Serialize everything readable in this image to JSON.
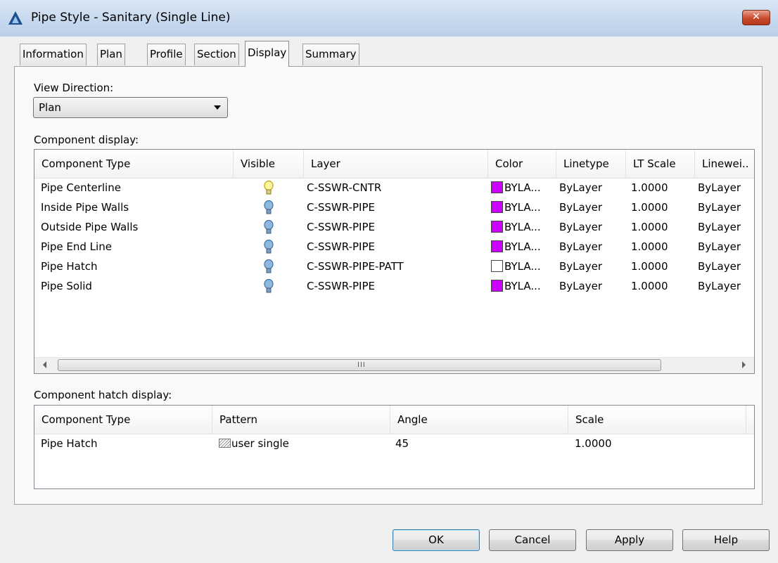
{
  "window": {
    "title": "Pipe Style - Sanitary (Single Line)",
    "close_glyph": "✕"
  },
  "tabs": [
    {
      "label": "Information"
    },
    {
      "label": "Plan"
    },
    {
      "label": "Profile"
    },
    {
      "label": "Section"
    },
    {
      "label": "Display",
      "active": true
    },
    {
      "label": "Summary"
    }
  ],
  "view_direction": {
    "label": "View Direction:",
    "value": "Plan"
  },
  "component_display": {
    "label": "Component display:",
    "columns": [
      "Component Type",
      "Visible",
      "Layer",
      "Color",
      "Linetype",
      "LT Scale",
      "Linewei.."
    ],
    "rows": [
      {
        "type": "Pipe Centerline",
        "visible": "on",
        "layer": "C-SSWR-CNTR",
        "color_hex": "#cc00ff",
        "color": "BYLA...",
        "linetype": "ByLayer",
        "lt_scale": "1.0000",
        "lineweight": "ByLayer"
      },
      {
        "type": "Inside Pipe Walls",
        "visible": "off",
        "layer": "C-SSWR-PIPE",
        "color_hex": "#cc00ff",
        "color": "BYLA...",
        "linetype": "ByLayer",
        "lt_scale": "1.0000",
        "lineweight": "ByLayer"
      },
      {
        "type": "Outside Pipe Walls",
        "visible": "off",
        "layer": "C-SSWR-PIPE",
        "color_hex": "#cc00ff",
        "color": "BYLA...",
        "linetype": "ByLayer",
        "lt_scale": "1.0000",
        "lineweight": "ByLayer"
      },
      {
        "type": "Pipe End Line",
        "visible": "off",
        "layer": "C-SSWR-PIPE",
        "color_hex": "#cc00ff",
        "color": "BYLA...",
        "linetype": "ByLayer",
        "lt_scale": "1.0000",
        "lineweight": "ByLayer"
      },
      {
        "type": "Pipe Hatch",
        "visible": "off",
        "layer": "C-SSWR-PIPE-PATT",
        "color_hex": "#ffffff",
        "color": "BYLA...",
        "linetype": "ByLayer",
        "lt_scale": "1.0000",
        "lineweight": "ByLayer"
      },
      {
        "type": "Pipe Solid",
        "visible": "off",
        "layer": "C-SSWR-PIPE",
        "color_hex": "#cc00ff",
        "color": "BYLA...",
        "linetype": "ByLayer",
        "lt_scale": "1.0000",
        "lineweight": "ByLayer"
      }
    ],
    "scroll_grip": "III"
  },
  "component_hatch_display": {
    "label": "Component hatch display:",
    "columns": [
      "Component Type",
      "Pattern",
      "Angle",
      "Scale"
    ],
    "rows": [
      {
        "type": "Pipe Hatch",
        "pattern": "user single",
        "angle": "45",
        "scale": "1.0000"
      }
    ]
  },
  "buttons": {
    "ok": "OK",
    "cancel": "Cancel",
    "apply": "Apply",
    "help": "Help"
  },
  "icons": {
    "app": "autocad-civil-icon",
    "visible_on": "lightbulb-on-icon",
    "visible_off": "lightbulb-off-icon",
    "pattern": "hatch-pattern-icon"
  }
}
